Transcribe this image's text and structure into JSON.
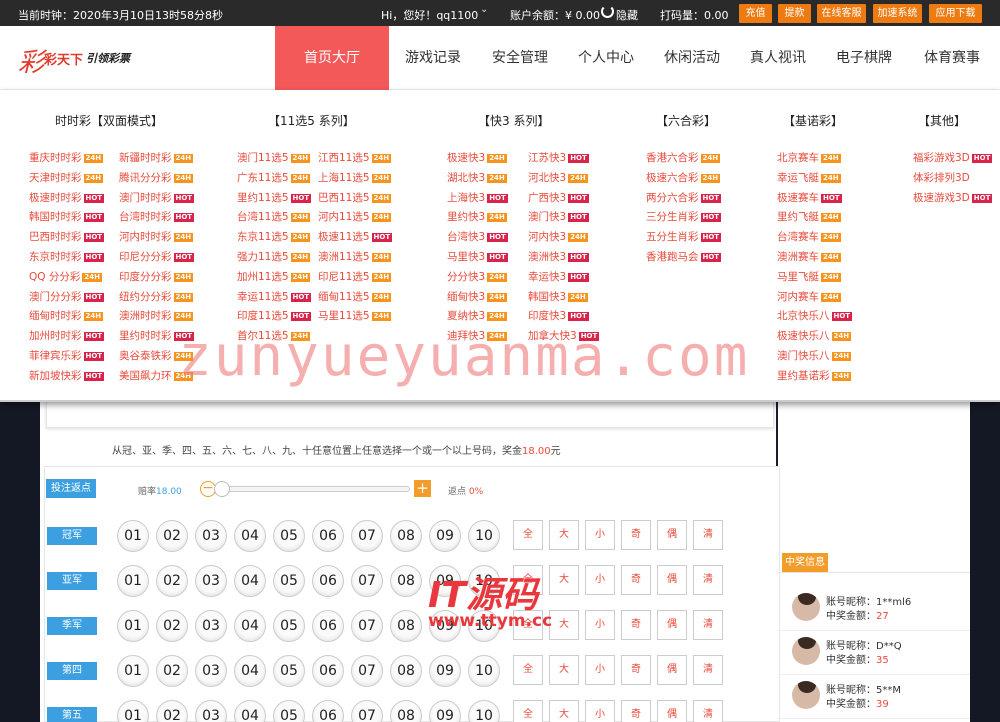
{
  "topbar": {
    "time": "当前时钟：2020年3月10日13时58分8秒",
    "greeting": "Hi，您好！qq1100",
    "balance_label": "账户余额：",
    "balance_value": "¥ 0.00",
    "hide_label": "隐藏",
    "code_label": "打码量：0.00",
    "buttons": [
      "充值",
      "提款",
      "在线客服",
      "加速系统",
      "应用下载"
    ]
  },
  "header": {
    "logo_mark": "彩",
    "logo_name": "彩天下",
    "logo_slogan": "引领彩票",
    "nav": [
      "首页大厅",
      "游戏记录",
      "安全管理",
      "个人中心",
      "休闲活动",
      "真人视讯",
      "电子棋牌",
      "体育赛事"
    ]
  },
  "menu": {
    "categories": [
      "时时彩【双面模式】",
      "【11选5 系列】",
      "【快3 系列】",
      "【六合彩】",
      "【基诺彩】",
      "【其他】"
    ],
    "col_ssc_a": [
      [
        "重庆时时彩",
        "24H"
      ],
      [
        "天津时时彩",
        "24H"
      ],
      [
        "极速时时彩",
        "HOT"
      ],
      [
        "韩国时时彩",
        "HOT"
      ],
      [
        "巴西时时彩",
        "HOT"
      ],
      [
        "东京时时彩",
        "HOT"
      ],
      [
        "QQ 分分彩",
        "24H"
      ],
      [
        "澳门分分彩",
        "HOT"
      ],
      [
        "缅甸时时彩",
        "24H"
      ],
      [
        "加州时时彩",
        "HOT"
      ],
      [
        "菲律宾乐彩",
        "HOT"
      ],
      [
        "新加坡快彩",
        "HOT"
      ]
    ],
    "col_ssc_b": [
      [
        "新疆时时彩",
        "24H"
      ],
      [
        "腾讯分分彩",
        "24H"
      ],
      [
        "澳门时时彩",
        "HOT"
      ],
      [
        "台湾时时彩",
        "HOT"
      ],
      [
        "河内时时彩",
        "24H"
      ],
      [
        "印尼分分彩",
        "HOT"
      ],
      [
        "印度分分彩",
        "24H"
      ],
      [
        "纽约分分彩",
        "24H"
      ],
      [
        "澳洲时时彩",
        "24H"
      ],
      [
        "里约时时彩",
        "HOT"
      ],
      [
        "奥谷泰铁彩",
        "24H"
      ],
      [
        "美国飙力环",
        "24H"
      ]
    ],
    "col_11x5_a": [
      [
        "澳门11选5",
        "24H"
      ],
      [
        "广东11选5",
        "24H"
      ],
      [
        "里约11选5",
        "HOT"
      ],
      [
        "台湾11选5",
        "24H"
      ],
      [
        "东京11选5",
        "24H"
      ],
      [
        "强力11选5",
        "24H"
      ],
      [
        "加州11选5",
        "24H"
      ],
      [
        "幸运11选5",
        "HOT"
      ],
      [
        "印度11选5",
        "HOT"
      ],
      [
        "首尔11选5",
        "24H"
      ]
    ],
    "col_11x5_b": [
      [
        "江西11选5",
        "24H"
      ],
      [
        "上海11选5",
        "24H"
      ],
      [
        "巴西11选5",
        "24H"
      ],
      [
        "河内11选5",
        "24H"
      ],
      [
        "极速11选5",
        "HOT"
      ],
      [
        "澳洲11选5",
        "24H"
      ],
      [
        "印尼11选5",
        "24H"
      ],
      [
        "缅甸11选5",
        "24H"
      ],
      [
        "马里11选5",
        "24H"
      ]
    ],
    "col_k3_a": [
      [
        "极速快3",
        "24H"
      ],
      [
        "湖北快3",
        "24H"
      ],
      [
        "上海快3",
        "HOT"
      ],
      [
        "里约快3",
        "24H"
      ],
      [
        "台湾快3",
        "HOT"
      ],
      [
        "马里快3",
        "HOT"
      ],
      [
        "分分快3",
        "24H"
      ],
      [
        "缅甸快3",
        "24H"
      ],
      [
        "夏纳快3",
        "24H"
      ],
      [
        "迪拜快3",
        "24H"
      ]
    ],
    "col_k3_b": [
      [
        "江苏快3",
        "HOT"
      ],
      [
        "河北快3",
        "24H"
      ],
      [
        "广西快3",
        "HOT"
      ],
      [
        "澳门快3",
        "HOT"
      ],
      [
        "河内快3",
        "24H"
      ],
      [
        "澳洲快3",
        "HOT"
      ],
      [
        "幸运快3",
        "HOT"
      ],
      [
        "韩国快3",
        "24H"
      ],
      [
        "印度快3",
        "HOT"
      ],
      [
        "加拿大快3",
        "HOT"
      ]
    ],
    "col_lhc": [
      [
        "香港六合彩",
        "24H"
      ],
      [
        "极速六合彩",
        "24H"
      ],
      [
        "两分六合彩",
        "HOT"
      ],
      [
        "三分生肖彩",
        "HOT"
      ],
      [
        "五分生肖彩",
        "HOT"
      ],
      [
        "香港跑马会",
        "HOT"
      ]
    ],
    "col_keno": [
      [
        "北京赛车",
        "24H"
      ],
      [
        "幸运飞艇",
        "24H"
      ],
      [
        "极速赛车",
        "HOT"
      ],
      [
        "里约飞艇",
        "24H"
      ],
      [
        "台湾赛车",
        "24H"
      ],
      [
        "澳洲赛车",
        "24H"
      ],
      [
        "马里飞艇",
        "24H"
      ],
      [
        "河内赛车",
        "24H"
      ],
      [
        "北京快乐八",
        "HOT"
      ],
      [
        "极速快乐八",
        "24H"
      ],
      [
        "澳门快乐八",
        "24H"
      ],
      [
        "里约基诺彩",
        "24H"
      ]
    ],
    "col_other": [
      [
        "福彩游戏3D",
        "HOT"
      ],
      [
        "体彩排列3D",
        ""
      ],
      [
        "极速游戏3D",
        "HOT"
      ]
    ]
  },
  "game": {
    "description_prefix": "从冠、亚、季、四、五、六、七、八、九、十任意位置上任意选择一个或一个以上号码，奖金",
    "description_amount": "18.00",
    "description_suffix": "元",
    "rebate_button": "投注返点",
    "odds_label": "赔率",
    "odds_value": "18.00",
    "rebate_label": "返点",
    "rebate_value": "0%",
    "rows": [
      "冠军",
      "亚军",
      "季军",
      "第四",
      "第五"
    ],
    "numbers": [
      "01",
      "02",
      "03",
      "04",
      "05",
      "06",
      "07",
      "08",
      "09",
      "10"
    ],
    "quick": [
      "全",
      "大",
      "小",
      "奇",
      "偶",
      "清"
    ]
  },
  "winners": {
    "title": "中奖信息",
    "nick_label": "账号昵称：",
    "amount_label": "中奖金额：",
    "list": [
      {
        "nick": "1**ml6",
        "amount": "27"
      },
      {
        "nick": "D**Q",
        "amount": "35"
      },
      {
        "nick": "5**M",
        "amount": "39"
      }
    ]
  },
  "watermarks": {
    "main": "zunyueyuanma.com",
    "brand": "IT源码",
    "url": "www.ttym.cc"
  },
  "colors": {
    "accent": "#f4595a",
    "orange": "#ee7b12",
    "blue": "#3ca0e0",
    "red": "#e84a3a"
  }
}
